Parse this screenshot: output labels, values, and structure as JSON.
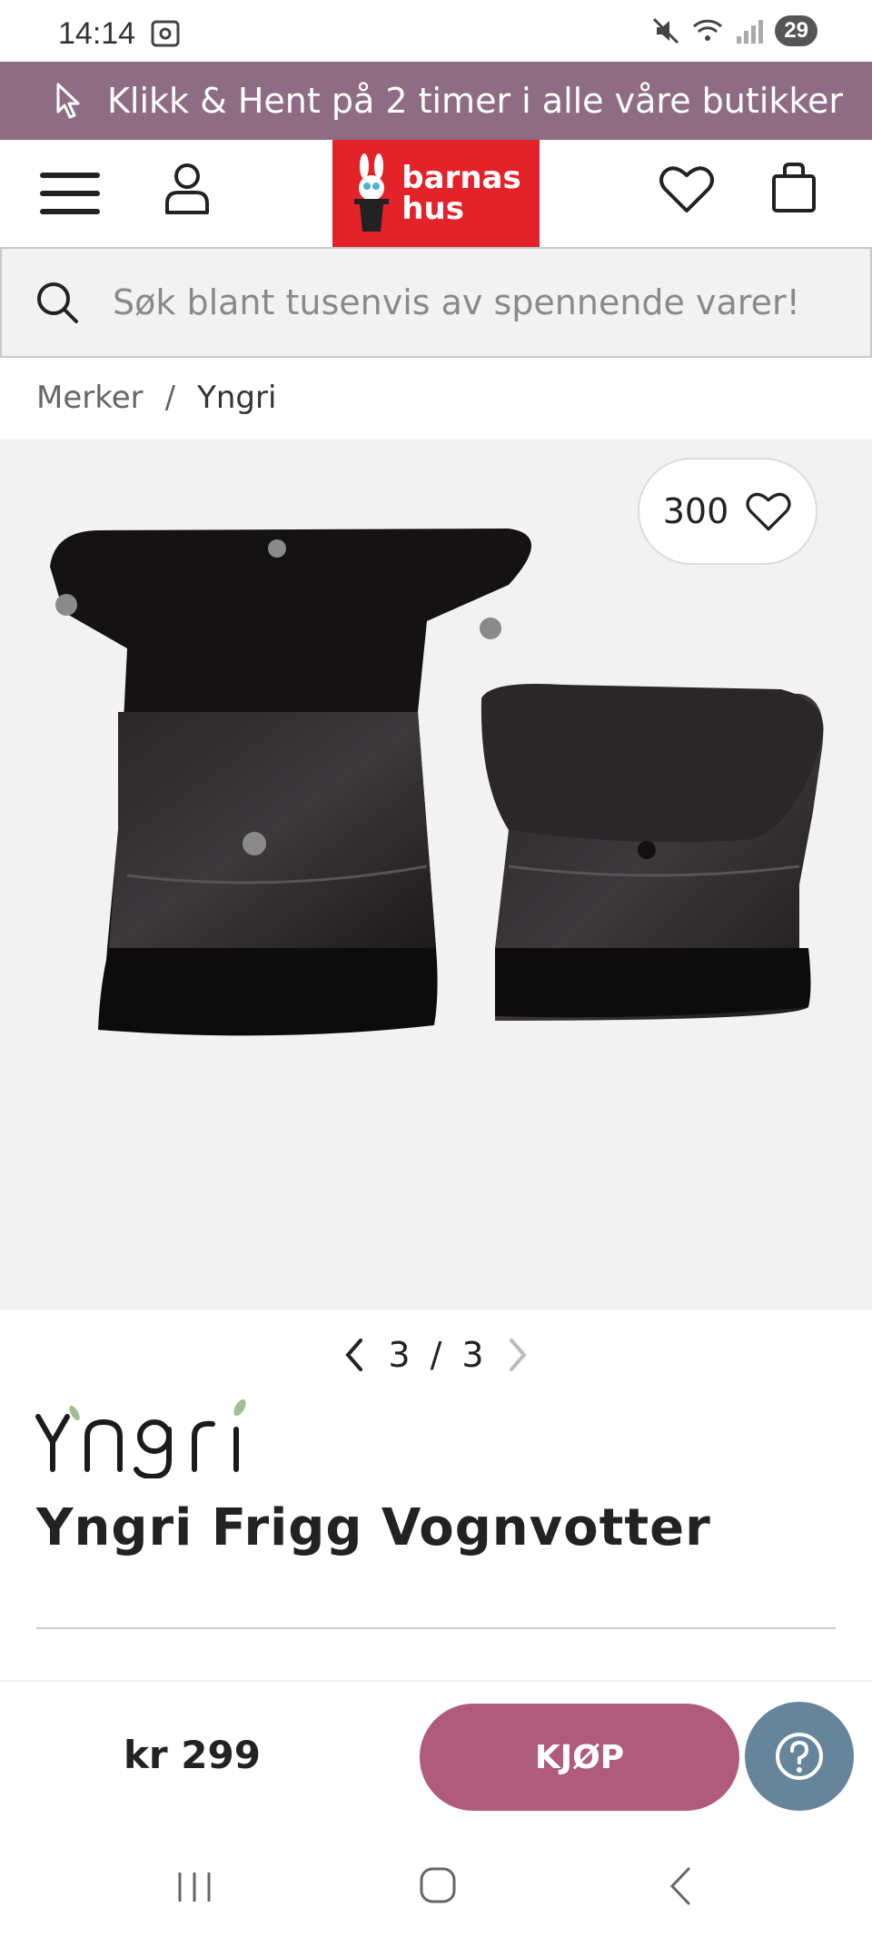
{
  "status_bar": {
    "time": "14:14",
    "battery": "29"
  },
  "promo": {
    "text": "Klikk & Hent på 2 timer i alle våre butikker",
    "icon": "cursor-icon"
  },
  "header": {
    "logo_line1": "barnas",
    "logo_line2": "hus"
  },
  "search": {
    "placeholder": "Søk blant tusenvis av spennende varer!"
  },
  "breadcrumb": {
    "items": [
      "Merker",
      "Yngri"
    ],
    "separator": "/"
  },
  "gallery": {
    "favorites_count": "300",
    "page_current": "3",
    "page_separator": "/",
    "page_total": "3"
  },
  "product": {
    "brand": "Yngri",
    "title": "Yngri Frigg Vognvotter"
  },
  "buy_bar": {
    "price": "kr 299",
    "buy_label": "KJØP",
    "help_icon": "question-icon"
  },
  "colors": {
    "promo_bg": "#8e6c84",
    "logo_bg": "#e3222a",
    "buy_bg": "#b05a7c",
    "help_bg": "#66859a"
  }
}
